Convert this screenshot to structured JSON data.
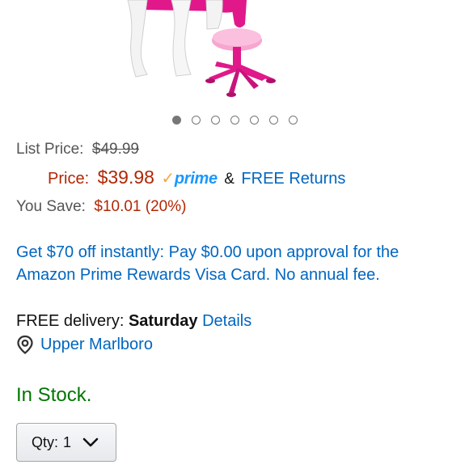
{
  "carousel": {
    "count": 7,
    "active_index": 0
  },
  "pricing": {
    "list_price_label": "List Price:",
    "list_price_value": "$49.99",
    "price_label": "Price:",
    "price_value": "$39.98",
    "prime_text": "prime",
    "amp": "&",
    "free_returns": "FREE Returns",
    "you_save_label": "You Save:",
    "you_save_value": "$10.01 (20%)"
  },
  "promo": {
    "text": "Get $70 off instantly: Pay $0.00 upon approval for the Amazon Prime Rewards Visa Card. No annual fee."
  },
  "delivery": {
    "prefix": "FREE delivery:",
    "day": "Saturday",
    "details_link": "Details",
    "location": "Upper Marlboro"
  },
  "stock": {
    "status": "In Stock."
  },
  "quantity": {
    "label": "Qty:",
    "value": "1"
  },
  "colors": {
    "price_red": "#B12704",
    "link_blue": "#0066C0",
    "stock_green": "#007600",
    "prime_blue": "#1a98ff",
    "prime_orange": "#f3a847",
    "product_pink": "#e0188a"
  },
  "icons": [
    "location-pin-icon",
    "chevron-down-icon",
    "prime-check-icon"
  ]
}
